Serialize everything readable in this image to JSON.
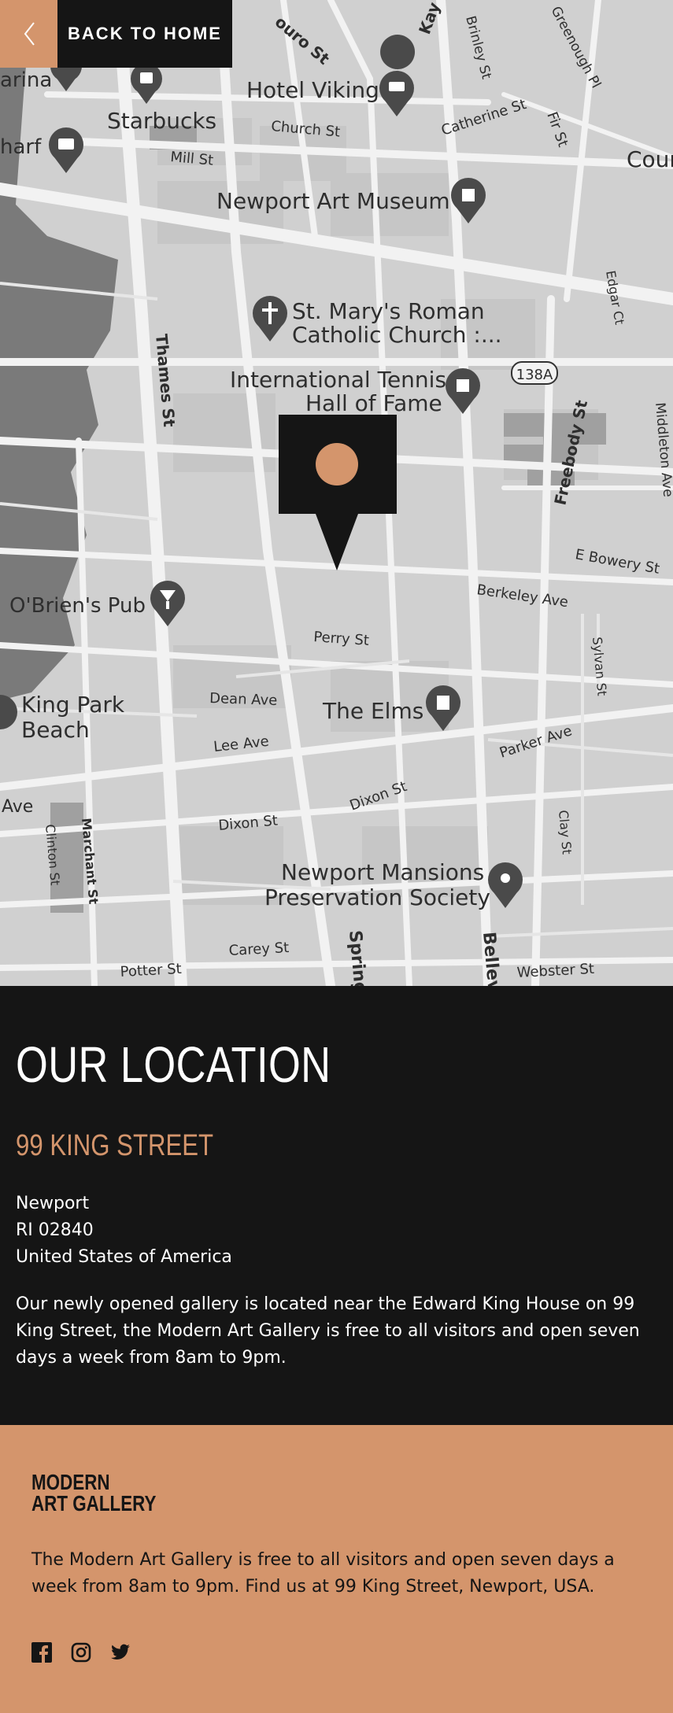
{
  "nav": {
    "back_label": "BACK TO HOME"
  },
  "map": {
    "labels": {
      "ouro_st": "ouro St",
      "kay_st": "Kay St",
      "brinley_st": "Brinley St",
      "greenough_pl": "Greenough Pl",
      "arina": "arina",
      "hotel_viking": "Hotel Viking",
      "starbucks": "Starbucks",
      "church_st": "Church St",
      "catherine_st": "Catherine St",
      "fir_st": "Fir St",
      "cour": "Cour",
      "harf": "harf",
      "mill_st": "Mill St",
      "newport_art_museum": "Newport Art Museum",
      "st_marys_1": "St. Mary's Roman",
      "st_marys_2": "Catholic Church :...",
      "edgar_ct": "Edgar Ct",
      "thames_st": "Thames St",
      "tennis_1": "International Tennis",
      "tennis_2": "Hall of Fame",
      "route_138a": "138A",
      "freebody_st": "Freebody St",
      "middleton_ave": "Middleton Ave",
      "e_bowery_st": "E Bowery St",
      "obriens_pub": "O'Brien's Pub",
      "berkeley_ave": "Berkeley Ave",
      "perry_st": "Perry St",
      "sylvan_st": "Sylvan St",
      "king_park_1": "King Park",
      "king_park_2": "Beach",
      "dean_ave": "Dean Ave",
      "the_elms": "The Elms",
      "lee_ave": "Lee Ave",
      "parker_ave": "Parker Ave",
      "ave": "Ave",
      "clinton_st": "Clinton St",
      "marchant_st": "Marchant St",
      "dixon_st_1": "Dixon St",
      "dixon_st_2": "Dixon St",
      "clay_st": "Clay St",
      "mansions_1": "Newport Mansions",
      "mansions_2": "Preservation Society",
      "spring": "Spring",
      "bellev": "Bellev",
      "carey_st": "Carey St",
      "potter_st": "Potter St",
      "webster_st": "Webster St"
    }
  },
  "location": {
    "heading": "OUR LOCATION",
    "street": "99 KING STREET",
    "city": "Newport",
    "region": "RI 02840",
    "country": "United States of America",
    "description": "Our newly opened gallery is located near the Edward King House on 99 King Street, the Modern Art Gallery is free to all visitors and open seven days a week from 8am to 9pm."
  },
  "footer": {
    "logo_line1": "MODERN",
    "logo_line2": "ART GALLERY",
    "text": "The Modern Art Gallery is free to all visitors and open seven days a week from 8am to 9pm. Find us at 99 King Street, Newport, USA.",
    "social_icons": [
      "facebook-icon",
      "instagram-icon",
      "twitter-icon"
    ]
  },
  "colors": {
    "accent": "#d4956c",
    "dark": "#151515",
    "map_bg": "#d0d0d0"
  }
}
